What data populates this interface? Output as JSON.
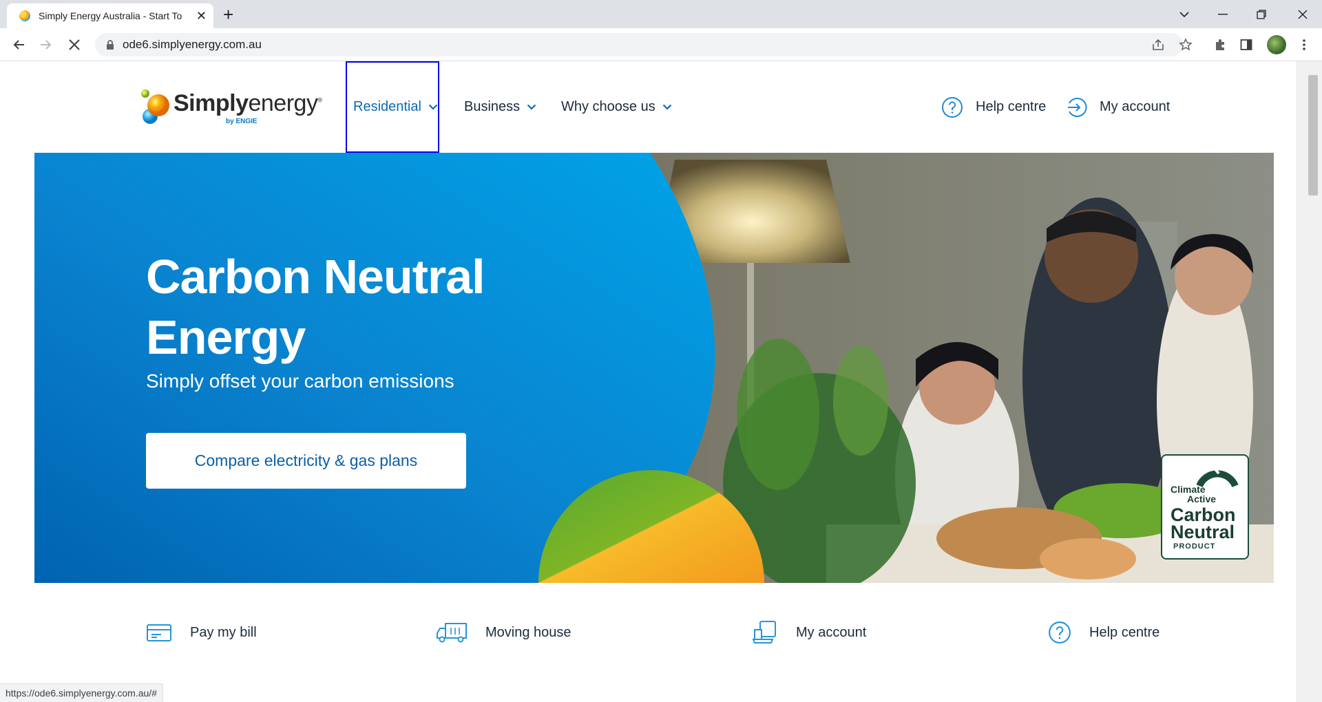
{
  "browser": {
    "tab_title": "Simply Energy Australia - Start To",
    "url": "ode6.simplyenergy.com.au",
    "status_url": "https://ode6.simplyenergy.com.au/#"
  },
  "header": {
    "logo": {
      "word_simply": "Simply",
      "word_energy": "energy",
      "byline": "by ENGIE",
      "registered": "®"
    },
    "nav": [
      {
        "label": "Residential",
        "active": true
      },
      {
        "label": "Business"
      },
      {
        "label": "Why choose us"
      }
    ],
    "utility": [
      {
        "label": "Help centre",
        "icon": "question-circle-icon"
      },
      {
        "label": "My account",
        "icon": "login-arrow-icon"
      }
    ]
  },
  "hero": {
    "title": "Carbon Neutral Energy",
    "subtitle": "Simply offset your carbon emissions",
    "cta": "Compare electricity & gas plans",
    "badge": {
      "line1": "Climate",
      "line2": "Active",
      "line3": "Carbon Neutral",
      "line4": "PRODUCT"
    }
  },
  "quick_links": [
    {
      "label": "Pay my bill",
      "icon": "bill-card-icon"
    },
    {
      "label": "Moving house",
      "icon": "moving-truck-icon"
    },
    {
      "label": "My account",
      "icon": "laptop-account-icon"
    },
    {
      "label": "Help centre",
      "icon": "question-circle-icon"
    }
  ],
  "colors": {
    "brand_blue": "#0b6ab2",
    "hero_blue_light": "#00a3e8",
    "hero_blue_dark": "#0063b1",
    "focus_outline": "#0000ee",
    "icon_blue": "#2596d6"
  }
}
